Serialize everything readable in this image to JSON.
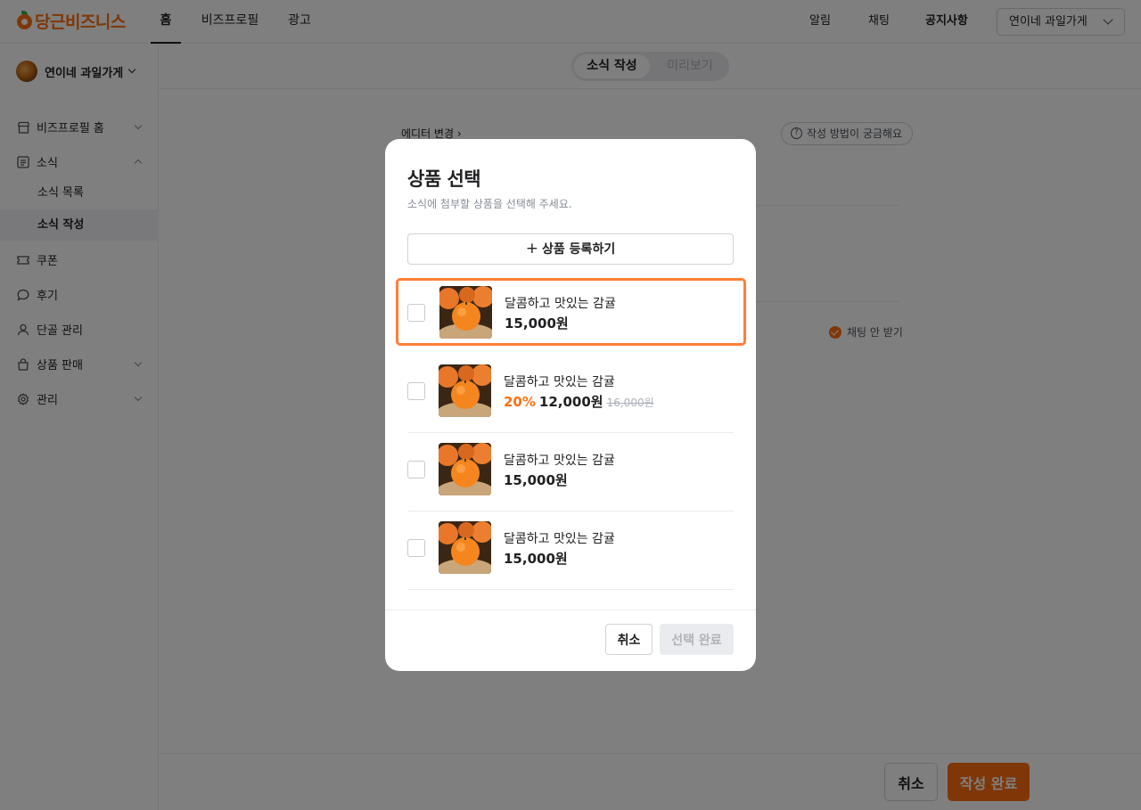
{
  "app": {
    "logo_text": "당근비즈니스",
    "brand_color": "#ff6f0f",
    "nav_tabs": [
      {
        "label": "홈",
        "active": true
      },
      {
        "label": "비즈프로필",
        "active": false
      },
      {
        "label": "광고",
        "active": false
      }
    ],
    "nav_right": {
      "alerts": "알림",
      "chat": "채팅",
      "notices": "공지사항"
    },
    "store_select": "연이네 과일가게"
  },
  "sidebar": {
    "store_name": "연이네 과일가게",
    "items": [
      {
        "label": "비즈프로필 홈",
        "icon": "store-icon",
        "arrow": "down"
      },
      {
        "label": "소식",
        "icon": "news-icon",
        "arrow": "up"
      },
      {
        "label": "쿠폰",
        "icon": "coupon-icon",
        "arrow": ""
      },
      {
        "label": "후기",
        "icon": "review-icon",
        "arrow": ""
      },
      {
        "label": "단골 관리",
        "icon": "person-icon",
        "arrow": ""
      },
      {
        "label": "상품 판매",
        "icon": "bag-icon",
        "arrow": "down"
      },
      {
        "label": "관리",
        "icon": "gear-icon",
        "arrow": "down"
      }
    ],
    "news_sub": [
      {
        "label": "소식 목록",
        "active": false
      },
      {
        "label": "소식 작성",
        "active": true
      }
    ]
  },
  "editor": {
    "segment": {
      "write": "소식 작성",
      "preview": "미리보기"
    },
    "editor_change": "에디터 변경",
    "help": "작성 방법이 궁금해요",
    "no_chat": "채팅 안 받기",
    "footer": {
      "cancel": "취소",
      "done": "작성 완료"
    }
  },
  "modal": {
    "title": "상품 선택",
    "subtitle": "소식에 첨부할 상품을 선택해 주세요.",
    "add_button": "상품 등록하기",
    "products": [
      {
        "name": "달콤하고 맛있는 감귤",
        "price": "15,000원",
        "discount": "",
        "original_price": "",
        "checked": false
      },
      {
        "name": "달콤하고 맛있는 감귤",
        "price": "12,000원",
        "discount": "20%",
        "original_price": "16,000원",
        "checked": false
      },
      {
        "name": "달콤하고 맛있는 감귤",
        "price": "15,000원",
        "discount": "",
        "original_price": "",
        "checked": false
      },
      {
        "name": "달콤하고 맛있는 감귤",
        "price": "15,000원",
        "discount": "",
        "original_price": "",
        "checked": false
      }
    ],
    "cancel": "취소",
    "confirm": "선택 완료"
  }
}
